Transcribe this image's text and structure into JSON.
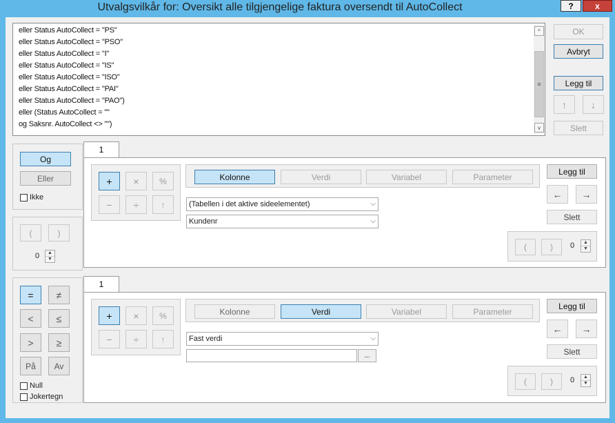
{
  "window": {
    "title": "Utvalgsvilkår for: Oversikt alle tilgjengelige faktura oversendt til AutoCollect",
    "help_label": "?",
    "close_label": "x"
  },
  "criteria_list": {
    "rows": [
      "eller Status AutoCollect = \"PS\"",
      "eller Status AutoCollect = \"PSO\"",
      "eller Status AutoCollect = \"I\"",
      "eller Status AutoCollect = \"IS\"",
      "eller Status AutoCollect = \"ISO\"",
      "eller Status AutoCollect = \"PAI\"",
      "eller Status AutoCollect = \"PAO\")",
      "eller (Status AutoCollect = \"\"",
      "og Saksnr. AutoCollect <> \"\")"
    ],
    "scroll_up": "^",
    "scroll_down": "v",
    "scroll_grip": "≡"
  },
  "right_buttons": {
    "ok": "OK",
    "cancel": "Avbryt",
    "add": "Legg til",
    "up": "↑",
    "down": "↓",
    "delete": "Slett"
  },
  "logic_panel": {
    "and": "Og",
    "or": "Eller",
    "not": "Ikke"
  },
  "paren_panel": {
    "open": "(",
    "close": ")",
    "value": "0"
  },
  "operator_panel": {
    "eq": "=",
    "ne": "≠",
    "lt": "<",
    "le": "≤",
    "gt": ">",
    "ge": "≥",
    "on": "På",
    "off": "Av",
    "null": "Null",
    "wildcard": "Jokertegn"
  },
  "expr1": {
    "tab": "1",
    "ops": {
      "plus": "+",
      "times": "×",
      "percent": "%",
      "minus": "−",
      "divide": "÷",
      "power": "↑"
    },
    "types": {
      "column": "Kolonne",
      "value": "Verdi",
      "variable": "Variabel",
      "parameter": "Parameter"
    },
    "selected_type": "Kolonne",
    "table_combo": "(Tabellen i det aktive sideelementet)",
    "column_combo": "Kundenr",
    "add": "Legg til",
    "left": "←",
    "right": "→",
    "delete": "Slett",
    "paren_open": "(",
    "paren_close": ")",
    "paren_value": "0"
  },
  "expr2": {
    "tab": "1",
    "ops": {
      "plus": "+",
      "times": "×",
      "percent": "%",
      "minus": "−",
      "divide": "÷",
      "power": "↑"
    },
    "types": {
      "column": "Kolonne",
      "value": "Verdi",
      "variable": "Variabel",
      "parameter": "Parameter"
    },
    "selected_type": "Verdi",
    "value_combo": "Fast verdi",
    "value_input": "",
    "browse": "...",
    "add": "Legg til",
    "left": "←",
    "right": "→",
    "delete": "Slett",
    "paren_open": "(",
    "paren_close": ")",
    "paren_value": "0"
  },
  "colors": {
    "title_bar": "#5fb8e8",
    "selected_button": "#c6e4f7",
    "close_button": "#c7413b"
  }
}
